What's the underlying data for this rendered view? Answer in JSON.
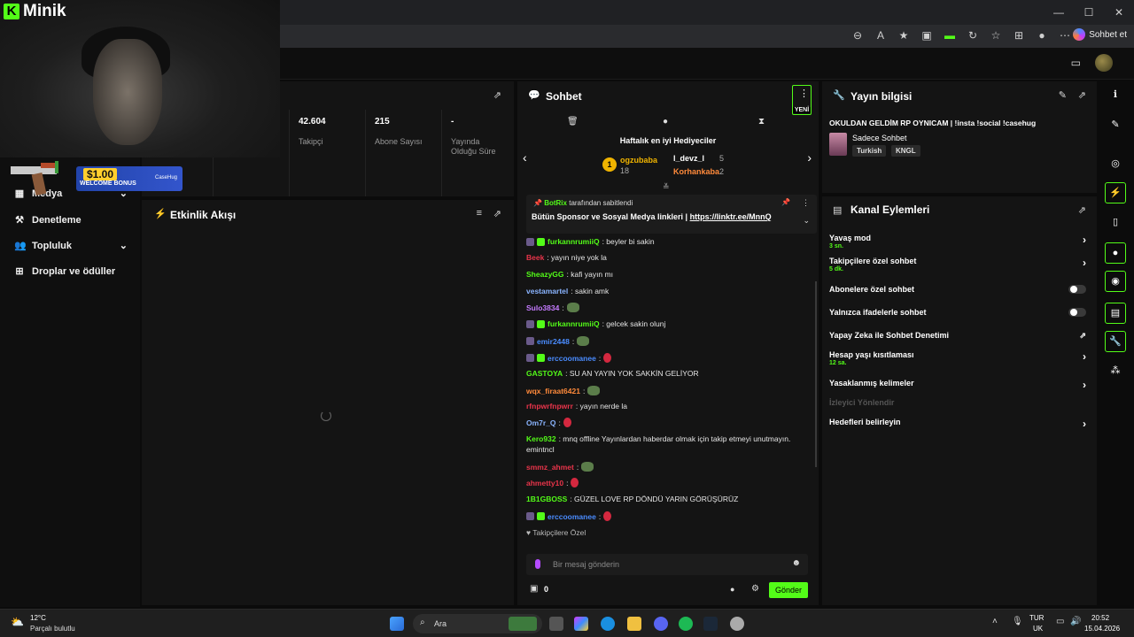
{
  "brand": {
    "name": "Minik",
    "logo_letter": "K"
  },
  "browser": {
    "sohbet_et": "Sohbet et",
    "window_buttons": [
      "—",
      "☐",
      "✕"
    ]
  },
  "promo": {
    "amount": "$1.00",
    "label": "WELCOME BONUS",
    "brand": "CaseHug"
  },
  "sidebar": {
    "items": [
      {
        "label": "Medya",
        "icon": "media-icon",
        "expandable": true
      },
      {
        "label": "Denetleme",
        "icon": "hammer-icon",
        "expandable": false
      },
      {
        "label": "Topluluk",
        "icon": "people-icon",
        "expandable": true
      },
      {
        "label": "Droplar ve ödüller",
        "icon": "gift-icon",
        "expandable": false
      }
    ]
  },
  "stats": {
    "items": [
      {
        "value": "42.604",
        "label": "Takipçi"
      },
      {
        "value": "215",
        "label": "Abone Sayısı"
      },
      {
        "value": "-",
        "label": "Yayında Olduğu Süre"
      }
    ]
  },
  "activity": {
    "title": "Etkinlik Akışı"
  },
  "chat": {
    "title": "Sohbet",
    "new_badge": "YENİ",
    "weekly_title": "Haftalık en iyi Hediyeciler",
    "gifters": [
      {
        "rank": "1",
        "name": "ogzubaba",
        "count": "18"
      },
      {
        "name": "l_devz_l",
        "count": "5"
      },
      {
        "name": "Korhankaba",
        "count": "2"
      }
    ],
    "pinned": {
      "by_user": "BotRix",
      "by_suffix": "tarafından sabitlendi",
      "text": "Bütün Sponsor ve Sosyal Medya linkleri | ",
      "link": "https://linktr.ee/MnnQ"
    },
    "messages": [
      {
        "user": "furkannrumiiQ",
        "color": "#53fc18",
        "text": ": beyler bi sakin",
        "badges": [
          "p",
          "g"
        ]
      },
      {
        "user": "Beek",
        "color": "#e8344a",
        "text": ": yayın niye yok la",
        "badges": []
      },
      {
        "user": "SheazyGG",
        "color": "#53fc18",
        "text": ": kafi yayın mı",
        "badges": []
      },
      {
        "user": "vestamartel",
        "color": "#8ab4ff",
        "text": ": sakin amk",
        "badges": []
      },
      {
        "user": "Sulo3834",
        "color": "#c57bff",
        "text": ":",
        "badges": [],
        "emote": "frog"
      },
      {
        "user": "furkannrumiiQ",
        "color": "#53fc18",
        "text": ": gelcek sakin olunj",
        "badges": [
          "p",
          "g"
        ]
      },
      {
        "user": "emir2448",
        "color": "#4a8cff",
        "text": ":",
        "badges": [
          "p"
        ],
        "emote": "frog"
      },
      {
        "user": "erccoomanee",
        "color": "#4a8cff",
        "text": ":",
        "badges": [
          "p",
          "g"
        ],
        "emote": "red"
      },
      {
        "user": "GASTOYA",
        "color": "#53fc18",
        "text": ": SU AN YAYIN YOK SAKKİN GELİYOR",
        "badges": []
      },
      {
        "user": "wqx_firaat6421",
        "color": "#ff8a3b",
        "text": ":",
        "badges": [],
        "emote": "frog"
      },
      {
        "user": "rfnpwrfnpwrr",
        "color": "#e8344a",
        "text": ": yayın nerde la",
        "badges": []
      },
      {
        "user": "Om7r_Q",
        "color": "#8ab4ff",
        "text": ":",
        "badges": [],
        "emote": "red"
      },
      {
        "user": "Kero932",
        "color": "#53fc18",
        "text": ": mnq offline Yayınlardan haberdar olmak için takip etmeyi unutmayın.",
        "badges": []
      },
      {
        "user": "",
        "color": "#e6e6e6",
        "text": "emintncl",
        "badges": []
      },
      {
        "user": "smmz_ahmet",
        "color": "#e8344a",
        "text": ":",
        "badges": [],
        "emote": "frog"
      },
      {
        "user": "ahmetty10",
        "color": "#e8344a",
        "text": ":",
        "badges": [],
        "emote": "red"
      },
      {
        "user": "1B1GBOSS",
        "color": "#53fc18",
        "text": ": GÜZEL LOVE RP DÖNDÜ YARIN GÖRÜŞÜRÜZ",
        "badges": []
      },
      {
        "user": "erccoomanee",
        "color": "#4a8cff",
        "text": ":",
        "badges": [
          "p",
          "g"
        ],
        "emote": "red"
      },
      {
        "user": "",
        "color": "#bbbbbb",
        "text": "♥ Takipçilere Özel",
        "badges": []
      }
    ],
    "input_placeholder": "Bir mesaj gönderin",
    "points": "0",
    "send_label": "Gönder"
  },
  "stream_info": {
    "title": "Yayın bilgisi",
    "stream_title": "OKULDAN GELDİM RP OYNICAM | !insta !social !casehug",
    "category": "Sadece Sohbet",
    "tags": [
      "Turkish",
      "KNGL"
    ]
  },
  "channel_actions": {
    "title": "Kanal Eylemleri",
    "rows": [
      {
        "label": "Yavaş mod",
        "sub": "3 sn.",
        "control": "chevron"
      },
      {
        "label": "Takipçilere özel sohbet",
        "sub": "5 dk.",
        "control": "chevron"
      },
      {
        "label": "Abonelere özel sohbet",
        "sub": "",
        "control": "toggle"
      },
      {
        "label": "Yalnızca ifadelerle sohbet",
        "sub": "",
        "control": "toggle"
      },
      {
        "label": "Yapay Zeka ile Sohbet Denetimi",
        "sub": "",
        "control": "external"
      },
      {
        "label": "Hesap yaşı kısıtlaması",
        "sub": "12 sa.",
        "control": "chevron"
      },
      {
        "label": "Yasaklanmış kelimeler",
        "sub": "",
        "control": "chevron"
      },
      {
        "label": "İzleyici Yönlendir",
        "sub": "",
        "control": "disabled"
      },
      {
        "label": "Hedefleri belirleyin",
        "sub": "",
        "control": "chevron"
      }
    ]
  },
  "taskbar": {
    "weather_temp": "12°C",
    "weather_desc": "Parçalı bulutlu",
    "search": "Ara",
    "lang1": "TUR",
    "lang2": "UK",
    "time": "20:52",
    "date": "15.04.2026"
  },
  "colors": {
    "accent": "#53fc18",
    "bg": "#0b0b0b",
    "panel": "#141414"
  }
}
